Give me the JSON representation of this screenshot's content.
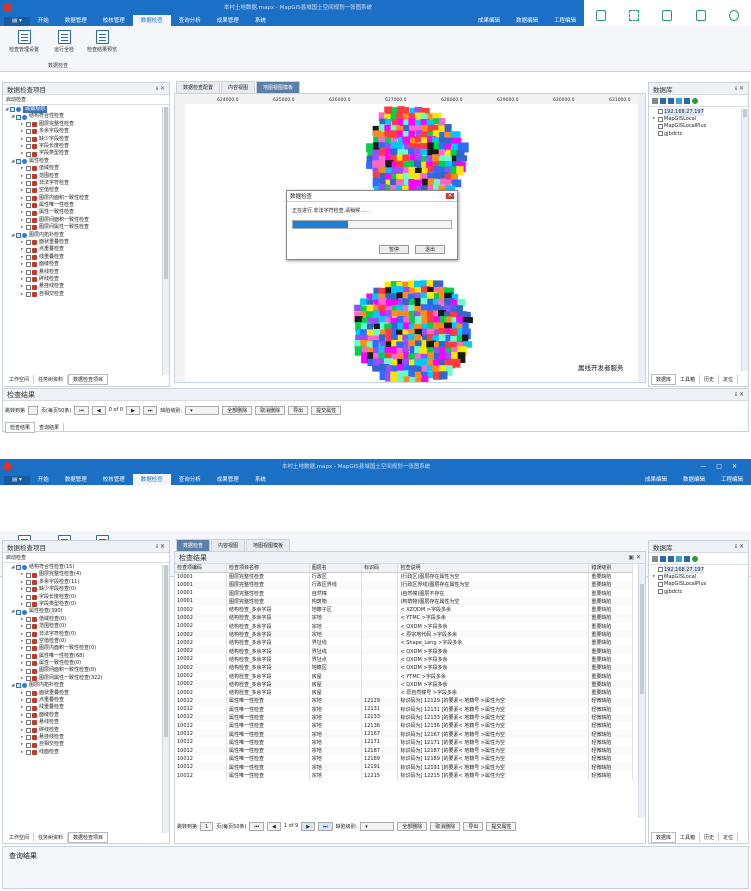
{
  "app": {
    "title": "本村土地数据.mapx - MapGIS县域国土空间规划一张图系统",
    "menu": [
      "开始",
      "数据管理",
      "校核管理",
      "数据检查",
      "查询分析",
      "成果管理",
      "系统"
    ],
    "active_menu": "数据检查",
    "right_menu": [
      "成果编辑",
      "数据编辑",
      "工程编辑"
    ]
  },
  "ribbon": {
    "buttons": [
      "检查管理设置",
      "运行全检",
      "检查结果预览"
    ],
    "group": "数据检查"
  },
  "left_panel": {
    "title": "数据检查项目",
    "subtitle": "启动检查",
    "root": "城镇规划"
  },
  "tree_top": [
    {
      "lvl": 1,
      "t": "结构符合性检查",
      "g": 1
    },
    {
      "lvl": 2,
      "t": "图层完整性检查"
    },
    {
      "lvl": 2,
      "t": "多余字段检查"
    },
    {
      "lvl": 2,
      "t": "缺少字段检查"
    },
    {
      "lvl": 2,
      "t": "字段长度检查"
    },
    {
      "lvl": 2,
      "t": "字段类型检查"
    },
    {
      "lvl": 1,
      "t": "属性检查",
      "g": 1
    },
    {
      "lvl": 2,
      "t": "值域检查"
    },
    {
      "lvl": 2,
      "t": "范围检查"
    },
    {
      "lvl": 2,
      "t": "非法字符检查"
    },
    {
      "lvl": 2,
      "t": "空值检查"
    },
    {
      "lvl": 2,
      "t": "图层内面积一致性检查"
    },
    {
      "lvl": 2,
      "t": "属性唯一性检查"
    },
    {
      "lvl": 2,
      "t": "属性一致性检查"
    },
    {
      "lvl": 2,
      "t": "图层间面积一致性检查"
    },
    {
      "lvl": 2,
      "t": "图层间属性一致性检查"
    },
    {
      "lvl": 1,
      "t": "图层内拓扑检查",
      "g": 1
    },
    {
      "lvl": 2,
      "t": "面状重叠检查"
    },
    {
      "lvl": 2,
      "t": "点重叠检查"
    },
    {
      "lvl": 2,
      "t": "线重叠检查"
    },
    {
      "lvl": 2,
      "t": "面缝检查"
    },
    {
      "lvl": 2,
      "t": "悬线检查"
    },
    {
      "lvl": 2,
      "t": "碎线检查"
    },
    {
      "lvl": 2,
      "t": "悬挂线检查"
    },
    {
      "lvl": 2,
      "t": "自相交检查"
    }
  ],
  "tree_bottom": [
    {
      "lvl": 1,
      "t": "结构符合性检查(15)",
      "g": 1
    },
    {
      "lvl": 2,
      "t": "图层完整性检查(4)"
    },
    {
      "lvl": 2,
      "t": "多余字段检查(11)"
    },
    {
      "lvl": 2,
      "t": "缺少字段检查(0)"
    },
    {
      "lvl": 2,
      "t": "字段长度检查(0)"
    },
    {
      "lvl": 2,
      "t": "字段类型检查(0)"
    },
    {
      "lvl": 1,
      "t": "属性检查(390)",
      "g": 1
    },
    {
      "lvl": 2,
      "t": "值域检查(0)"
    },
    {
      "lvl": 2,
      "t": "范围检查(0)"
    },
    {
      "lvl": 2,
      "t": "非法字符检查(0)"
    },
    {
      "lvl": 2,
      "t": "空值检查(0)"
    },
    {
      "lvl": 2,
      "t": "图层内面积一致性检查(0)"
    },
    {
      "lvl": 2,
      "t": "属性唯一性检查(68)"
    },
    {
      "lvl": 2,
      "t": "属性一致性检查(0)"
    },
    {
      "lvl": 2,
      "t": "图层间面积一致性检查(0)"
    },
    {
      "lvl": 2,
      "t": "图层间属性一致性检查(322)"
    },
    {
      "lvl": 1,
      "t": "图层内拓扑检查",
      "g": 1
    },
    {
      "lvl": 2,
      "t": "面状重叠检查"
    },
    {
      "lvl": 2,
      "t": "点重叠检查"
    },
    {
      "lvl": 2,
      "t": "线重叠检查"
    },
    {
      "lvl": 2,
      "t": "面缝检查"
    },
    {
      "lvl": 2,
      "t": "悬线检查"
    },
    {
      "lvl": 2,
      "t": "碎线检查"
    },
    {
      "lvl": 2,
      "t": "悬挂线检查"
    },
    {
      "lvl": 2,
      "t": "自相交检查"
    },
    {
      "lvl": 2,
      "t": "线面检查"
    }
  ],
  "left_tabs": [
    "工作空间",
    "任务树资料",
    "数据检查项目"
  ],
  "doc_tabs_top": [
    "数据检查配置",
    "内容视图",
    "地图视图模板"
  ],
  "doc_tabs_bottom": [
    "数据检查",
    "内容视图",
    "地图视图模板"
  ],
  "ruler_marks": [
    "624000.0",
    "625000.0",
    "626000.0",
    "627000.0",
    "628000.0",
    "629000.0",
    "630000.0",
    "631000.0"
  ],
  "dialog": {
    "title": "数据检查",
    "message": "正在进行 非法字符检查,请稍候……",
    "progress": 0.35,
    "pause": "暂停",
    "cancel": "退出"
  },
  "watermark": "属线开发者服务",
  "results": {
    "title": "检查结果",
    "columns": [
      "检查项编码",
      "检查项目名称",
      "图层名",
      "标识码",
      "检查说明",
      "错误级别"
    ],
    "rows": [
      [
        "10001",
        "图层完整性检查",
        "行政区",
        "",
        "(行政区)图层存在属性为空",
        "重要缺陷"
      ],
      [
        "10001",
        "图层完整性检查",
        "行政区界线",
        "",
        "(行政区界线)图层存在属性为空",
        "重要缺陷"
      ],
      [
        "10001",
        "图层完整性检查",
        "自然幢",
        "",
        "(自然幢)图层不存在",
        "重要缺陷"
      ],
      [
        "10001",
        "图层完整性检查",
        "构筑物",
        "",
        "(构筑物)图层存在属性为空",
        "重要缺陷"
      ],
      [
        "10002",
        "结构检查_多余字段",
        "地籍子区",
        "",
        "< XZQDM >字段多余",
        "重要缺陷"
      ],
      [
        "10002",
        "结构检查_多余字段",
        "宗地",
        "",
        "< YTMC >字段多余",
        "重要缺陷"
      ],
      [
        "10002",
        "结构检查_多余字段",
        "宗地",
        "",
        "< QXDM >字段多余",
        "重要缺陷"
      ],
      [
        "10002",
        "结构检查_多余字段",
        "宗地",
        "",
        "< 原宗地代码 >字段多余",
        "重要缺陷"
      ],
      [
        "10002",
        "结构检查_多余字段",
        "界址线",
        "",
        "< Shape_Leng >字段多余",
        "重要缺陷"
      ],
      [
        "10002",
        "结构检查_多余字段",
        "界址线",
        "",
        "< QXDM >字段多余",
        "重要缺陷"
      ],
      [
        "10002",
        "结构检查_多余字段",
        "界址点",
        "",
        "< QXDM >字段多余",
        "重要缺陷"
      ],
      [
        "10002",
        "结构检查_多余字段",
        "地籍区",
        "",
        "< QXDM >字段多余",
        "重要缺陷"
      ],
      [
        "10002",
        "结构检查_多余字段",
        "房屋",
        "",
        "< YTMC >字段多余",
        "重要缺陷"
      ],
      [
        "10002",
        "结构检查_多余字段",
        "房屋",
        "",
        "< QXDM >字段多余",
        "重要缺陷"
      ],
      [
        "10002",
        "结构检查_多余字段",
        "房屋",
        "",
        "< 原自然幢号 >字段多余",
        "重要缺陷"
      ],
      [
        "10012",
        "属性唯一性检查",
        "宗地",
        "12129",
        "标识码为[ 12129 ]的要素< 地籍号 >属性为空",
        "轻微缺陷"
      ],
      [
        "10012",
        "属性唯一性检查",
        "宗地",
        "12131",
        "标识码为[ 12131 ]的要素< 地籍号 >属性为空",
        "轻微缺陷"
      ],
      [
        "10012",
        "属性唯一性检查",
        "宗地",
        "12133",
        "标识码为[ 12133 ]的要素< 地籍号 >属性为空",
        "轻微缺陷"
      ],
      [
        "10012",
        "属性唯一性检查",
        "宗地",
        "12136",
        "标识码为[ 12136 ]的要素< 地籍号 >属性为空",
        "轻微缺陷"
      ],
      [
        "10012",
        "属性唯一性检查",
        "宗地",
        "12167",
        "标识码为[ 12167 ]的要素< 地籍号 >属性为空",
        "轻微缺陷"
      ],
      [
        "10012",
        "属性唯一性检查",
        "宗地",
        "12171",
        "标识码为[ 12171 ]的要素< 地籍号 >属性为空",
        "轻微缺陷"
      ],
      [
        "10012",
        "属性唯一性检查",
        "宗地",
        "12187",
        "标识码为[ 12187 ]的要素< 地籍号 >属性为空",
        "轻微缺陷"
      ],
      [
        "10012",
        "属性唯一性检查",
        "宗地",
        "12189",
        "标识码为[ 12189 ]的要素< 地籍号 >属性为空",
        "轻微缺陷"
      ],
      [
        "10012",
        "属性唯一性检查",
        "宗地",
        "12191",
        "标识码为[ 12191 ]的要素< 地籍号 >属性为空",
        "轻微缺陷"
      ],
      [
        "10012",
        "属性唯一性检查",
        "宗地",
        "12215",
        "标识码为[ 12215 ]的要素< 地籍号 >属性为空",
        "轻微缺陷"
      ]
    ]
  },
  "nav_top": {
    "page_size_label": "跳转到第",
    "page_unit": "页(每页50条)",
    "page_info": "0 of 0",
    "level_label": "缺陷级别:",
    "b1": "全部删除",
    "b2": "取消删除",
    "b3": "导出",
    "b4": "提交属性"
  },
  "nav_bottom": {
    "page_size_label": "跳转到第",
    "page_num": "1",
    "page_unit": "页(每页50条)",
    "page_info": "1 of 9",
    "level_label": "缺陷级别:",
    "b1": "全部删除",
    "b2": "取消删除",
    "b3": "导出",
    "b4": "提交属性"
  },
  "bottom_panel_top": {
    "title": "检查结果",
    "tabs": [
      "检查结果",
      "查询结果"
    ]
  },
  "bottom_panel_bottom": {
    "title": "查询结果"
  },
  "right_panel": {
    "title": "数据库",
    "items": [
      "192.168.27.197",
      "MapGISLocal",
      "MapGISLocalPlus",
      "gjbdctc"
    ],
    "tabs": [
      "数据库",
      "工具箱",
      "历史",
      "定位"
    ]
  },
  "colors": {
    "accent": "#1b6fc4"
  }
}
